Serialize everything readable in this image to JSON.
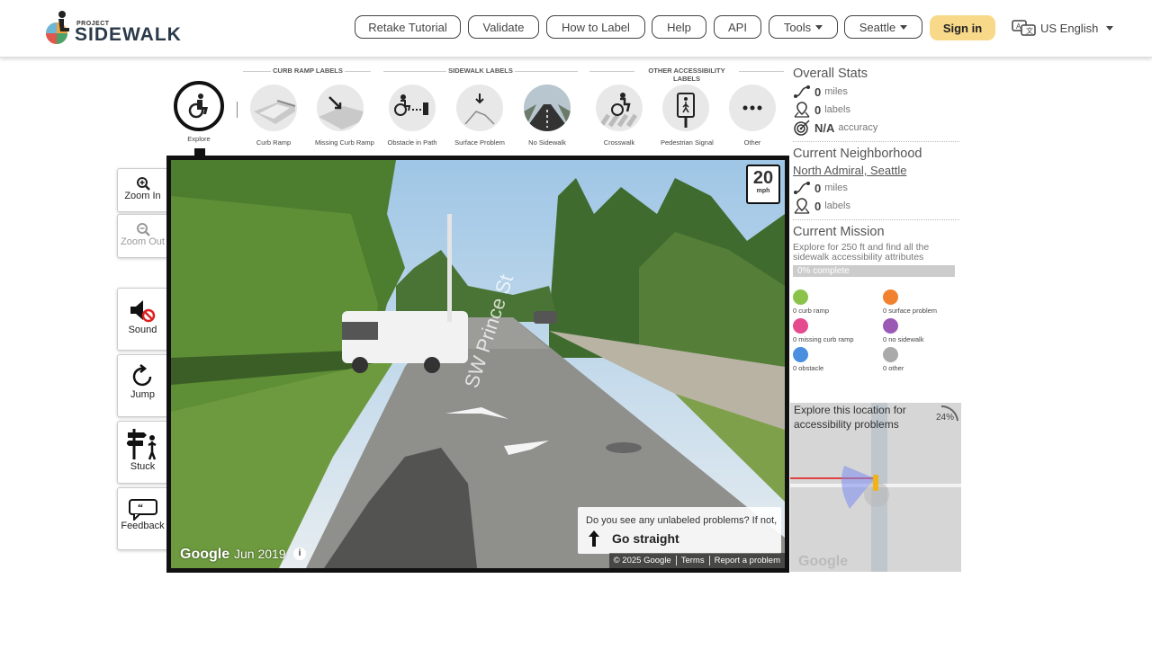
{
  "nav": {
    "logo_project": "PROJECT",
    "logo_sidewalk": "SIDEWALK",
    "buttons": [
      "Retake Tutorial",
      "Validate",
      "How to Label",
      "Help",
      "API"
    ],
    "tools": "Tools",
    "city": "Seattle",
    "signin": "Sign in",
    "language": "US English"
  },
  "toolbar": {
    "categories": {
      "curb": "CURB RAMP LABELS",
      "sidewalk": "SIDEWALK LABELS",
      "other": "OTHER ACCESSIBILITY LABELS"
    },
    "tools": {
      "explore": "Explore",
      "curb_ramp": "Curb Ramp",
      "missing_curb_ramp": "Missing Curb Ramp",
      "obstacle": "Obstacle in Path",
      "surface": "Surface Problem",
      "no_sidewalk": "No Sidewalk",
      "crosswalk": "Crosswalk",
      "signal": "Pedestrian Signal",
      "other": "Other"
    }
  },
  "left_controls": {
    "zoom_in": "Zoom In",
    "zoom_out": "Zoom Out",
    "sound": "Sound",
    "jump": "Jump",
    "stuck": "Stuck",
    "feedback": "Feedback"
  },
  "streetview": {
    "speed_value": "20",
    "speed_unit": "mph",
    "street_name": "SW Prince St",
    "prompt_question": "Do you see any unlabeled problems? If not,",
    "prompt_action": "Go straight",
    "google": "Google",
    "date": "Jun 2019",
    "copyright": "© 2025 Google",
    "terms": "Terms",
    "report": "Report a problem"
  },
  "overall": {
    "title": "Overall Stats",
    "miles_value": "0",
    "miles_unit": "miles",
    "labels_value": "0",
    "labels_unit": "labels",
    "accuracy_value": "N/A",
    "accuracy_unit": "accuracy"
  },
  "neighborhood": {
    "title": "Current Neighborhood",
    "name": "North Admiral, Seattle",
    "miles_value": "0",
    "miles_unit": "miles",
    "labels_value": "0",
    "labels_unit": "labels"
  },
  "mission": {
    "title": "Current Mission",
    "description": "Explore for 250 ft and find all the sidewalk accessibility attributes",
    "progress_text": "0% complete",
    "progress_fraction": 0
  },
  "legend": [
    {
      "text": "0 curb ramp",
      "color": "#8bc34a"
    },
    {
      "text": "0 surface problem",
      "color": "#f0812e"
    },
    {
      "text": "0 missing curb ramp",
      "color": "#e54a8f"
    },
    {
      "text": "0 no sidewalk",
      "color": "#9b59b6"
    },
    {
      "text": "0 obstacle",
      "color": "#4a8ee0"
    },
    {
      "text": "0 other",
      "color": "#aaaaaa"
    }
  ],
  "minimap": {
    "text": "Explore this location for accessibility problems",
    "percent": "24%",
    "google": "Google"
  }
}
